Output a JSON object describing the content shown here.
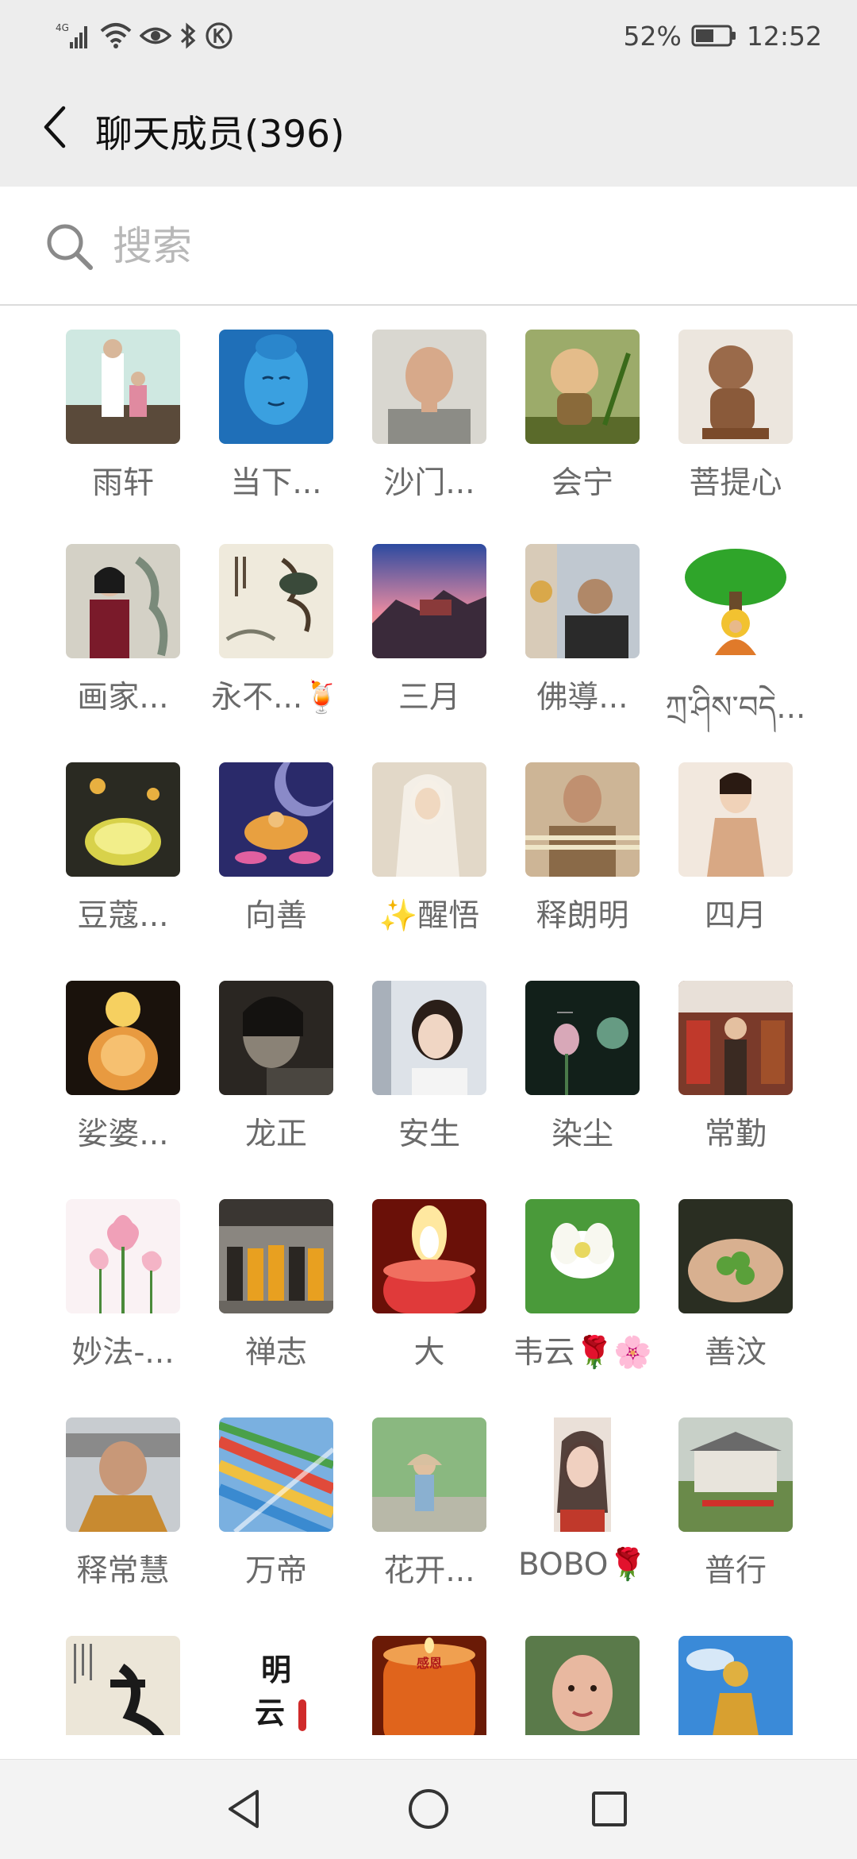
{
  "status_bar": {
    "signal": "4G",
    "battery": "52%",
    "time": "12:52",
    "icons": [
      "signal-icon",
      "wifi-icon",
      "eye-icon",
      "bluetooth-icon",
      "k-icon",
      "battery-icon"
    ]
  },
  "header": {
    "title": "聊天成员(396)",
    "back_icon": "chevron-left-icon"
  },
  "search": {
    "placeholder": "搜索",
    "value": ""
  },
  "members": [
    {
      "name": "雨轩",
      "color": "#8fc8c0"
    },
    {
      "name": "当下...",
      "color": "#2e84c8"
    },
    {
      "name": "沙门...",
      "color": "#9a9a92"
    },
    {
      "name": "会宁",
      "color": "#6f7f3a"
    },
    {
      "name": "菩提心",
      "color": "#b89577"
    },
    {
      "name": "画家...",
      "color": "#c9c6bd"
    },
    {
      "name": "永不...🍹",
      "color": "#e8e2d2"
    },
    {
      "name": "三月",
      "color": "#3c5a9a"
    },
    {
      "name": "佛導...",
      "color": "#7f90a8"
    },
    {
      "name": "ཀྲ་ཤིས་བདེ...",
      "color": "#39a035"
    },
    {
      "name": "豆蔻...",
      "color": "#2d2a1c"
    },
    {
      "name": "向善",
      "color": "#3d3a78"
    },
    {
      "name": "✨醒悟",
      "color": "#d9c9b3"
    },
    {
      "name": "释朗明",
      "color": "#a98d6a"
    },
    {
      "name": "四月",
      "color": "#e8d6c8"
    },
    {
      "name": "娑婆...",
      "color": "#3a2414"
    },
    {
      "name": "龙正",
      "color": "#3e3a34"
    },
    {
      "name": "安生",
      "color": "#c7ccd4"
    },
    {
      "name": "染尘",
      "color": "#1a2b20"
    },
    {
      "name": "常勤",
      "color": "#8d5a3a"
    },
    {
      "name": "妙法-...",
      "color": "#f5e4ea"
    },
    {
      "name": "禅志",
      "color": "#6d6a66"
    },
    {
      "name": "大",
      "color": "#d4392c"
    },
    {
      "name": "韦云🌹🌸",
      "color": "#6aae3a"
    },
    {
      "name": "善汶",
      "color": "#4e5b3a"
    },
    {
      "name": "释常慧",
      "color": "#b7a27a"
    },
    {
      "name": "万帝",
      "color": "#c06a3a"
    },
    {
      "name": "花开...",
      "color": "#7aa070"
    },
    {
      "name": "BOBO🌹",
      "color": "#efe6df"
    },
    {
      "name": "普行",
      "color": "#7a8a6a"
    },
    {
      "name": "",
      "color": "#ece6d8"
    },
    {
      "name": "",
      "color": "#ffffff"
    },
    {
      "name": "",
      "color": "#d9561c"
    },
    {
      "name": "",
      "color": "#5a7a4a"
    },
    {
      "name": "",
      "color": "#4a8ad0"
    }
  ],
  "avatar_texts": {
    "mingyun": "明\n云",
    "ganen": "感恩"
  },
  "nav_bar": {
    "icons": [
      "back-triangle-icon",
      "home-circle-icon",
      "recents-square-icon"
    ]
  }
}
